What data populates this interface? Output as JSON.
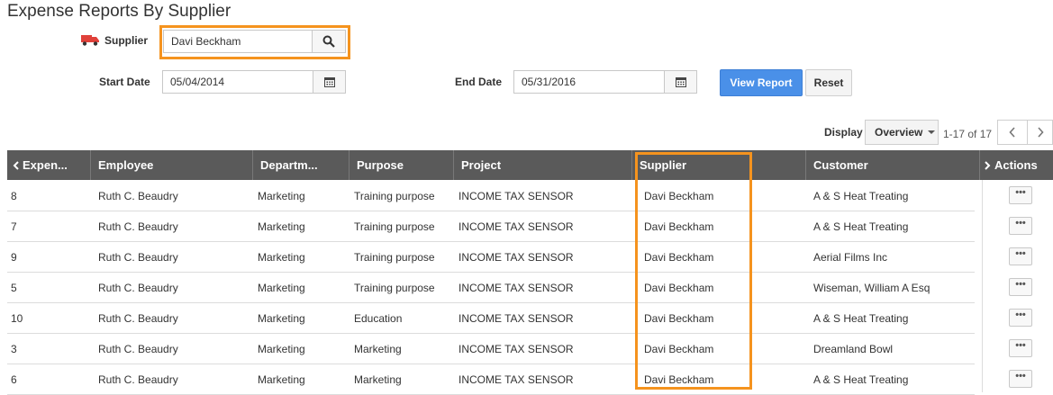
{
  "page_title": "Expense Reports By Supplier",
  "filters": {
    "supplier_label": "Supplier",
    "supplier_value": "Davi Beckham",
    "start_date_label": "Start Date",
    "start_date_value": "05/04/2014",
    "end_date_label": "End Date",
    "end_date_value": "05/31/2016",
    "view_report_label": "View Report",
    "reset_label": "Reset"
  },
  "toolbar": {
    "display_label": "Display",
    "display_value": "Overview",
    "page_count": "1-17 of 17"
  },
  "table": {
    "columns": [
      "Expen...",
      "Employee",
      "Departm...",
      "Purpose",
      "Project",
      "Supplier",
      "Customer",
      "Actions"
    ],
    "rows": [
      [
        "8",
        "Ruth C. Beaudry",
        "Marketing",
        "Training purpose",
        "INCOME TAX SENSOR",
        "Davi Beckham",
        "A & S Heat Treating"
      ],
      [
        "7",
        "Ruth C. Beaudry",
        "Marketing",
        "Training purpose",
        "INCOME TAX SENSOR",
        "Davi Beckham",
        "A & S Heat Treating"
      ],
      [
        "9",
        "Ruth C. Beaudry",
        "Marketing",
        "Training purpose",
        "INCOME TAX SENSOR",
        "Davi Beckham",
        "Aerial Films Inc"
      ],
      [
        "5",
        "Ruth C. Beaudry",
        "Marketing",
        "Training purpose",
        "INCOME TAX SENSOR",
        "Davi Beckham",
        "Wiseman, William A Esq"
      ],
      [
        "10",
        "Ruth C. Beaudry",
        "Marketing",
        "Education",
        "INCOME TAX SENSOR",
        "Davi Beckham",
        "A & S Heat Treating"
      ],
      [
        "3",
        "Ruth C. Beaudry",
        "Marketing",
        "Marketing",
        "INCOME TAX SENSOR",
        "Davi Beckham",
        "Dreamland Bowl"
      ],
      [
        "6",
        "Ruth C. Beaudry",
        "Marketing",
        "Marketing",
        "INCOME TAX SENSOR",
        "Davi Beckham",
        "A & S Heat Treating"
      ]
    ],
    "action_glyph": "•••"
  },
  "colors": {
    "highlight": "#f5931e",
    "primary_button": "#4a90e8",
    "header_bg": "#5a5a5a",
    "truck_icon": "#e0413a"
  },
  "icons": [
    "truck-icon",
    "search-icon",
    "calendar-icon",
    "chevron-left-icon",
    "chevron-right-icon",
    "caret-down-icon"
  ]
}
